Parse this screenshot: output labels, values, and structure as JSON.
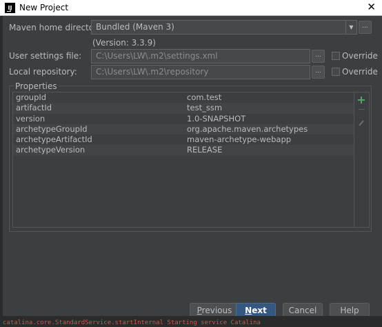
{
  "window": {
    "title": "New Project",
    "app_icon": "IJ",
    "close_glyph": "✕"
  },
  "maven": {
    "home_label": "Maven home directory:",
    "home_value": "Bundled (Maven 3)",
    "version_text": "(Version: 3.3.9)",
    "user_settings_label": "User settings file:",
    "user_settings_value": "C:\\Users\\LW\\.m2\\settings.xml",
    "local_repo_label": "Local repository:",
    "local_repo_value": "C:\\Users\\LW\\.m2\\repository",
    "override_label": "Override",
    "browse_glyph": "..."
  },
  "properties": {
    "title": "Properties",
    "rows": [
      {
        "key": "groupId",
        "value": "com.test"
      },
      {
        "key": "artifactId",
        "value": "test_ssm"
      },
      {
        "key": "version",
        "value": "1.0-SNAPSHOT"
      },
      {
        "key": "archetypeGroupId",
        "value": "org.apache.maven.archetypes"
      },
      {
        "key": "archetypeArtifactId",
        "value": "maven-archetype-webapp"
      },
      {
        "key": "archetypeVersion",
        "value": "RELEASE"
      }
    ],
    "add_glyph": "+"
  },
  "buttons": {
    "previous": "Previous",
    "next": "Next",
    "cancel": "Cancel",
    "help": "Help"
  },
  "background_console": "catalina.core.StandardService.startInternal Starting service Catalina",
  "colors": {
    "dialog_bg": "#3c3f41",
    "field_bg": "#45494a",
    "primary_button": "#365880",
    "add_icon": "#59a869",
    "console_error_text": "#d25252"
  },
  "icons": [
    "app-icon",
    "close-icon",
    "dropdown-arrow-icon",
    "browse-icon",
    "add-icon",
    "remove-icon",
    "edit-icon"
  ]
}
